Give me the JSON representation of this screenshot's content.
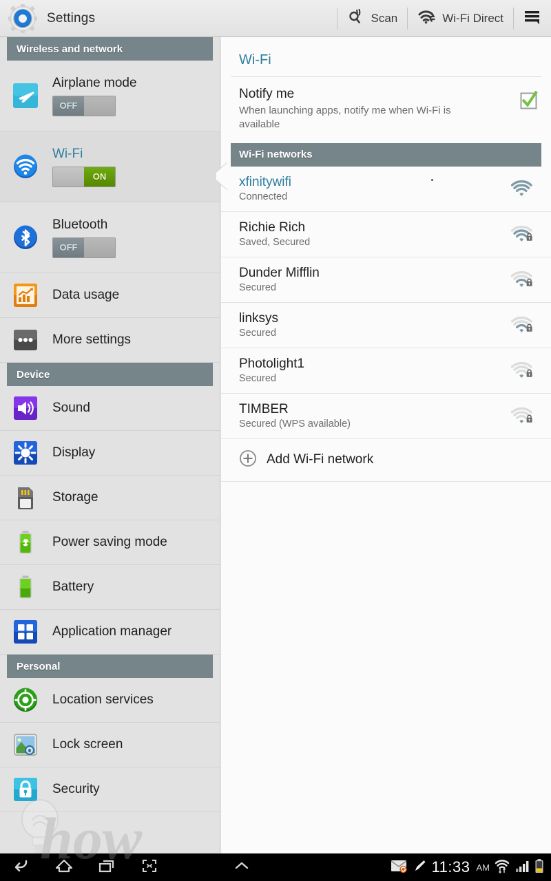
{
  "actionbar": {
    "app_icon": "settings-gear-icon",
    "title": "Settings",
    "scan_label": "Scan",
    "scan_icon": "scan-search-icon",
    "wifi_direct_label": "Wi-Fi Direct",
    "wifi_direct_icon": "wifi-direct-icon",
    "menu_icon": "overflow-menu-icon"
  },
  "sidebar": {
    "sections": [
      {
        "header": "Wireless and network",
        "items": [
          {
            "label": "Airplane mode",
            "icon": "airplane-icon",
            "toggle": "OFF",
            "selected": false
          },
          {
            "label": "Wi-Fi",
            "icon": "wifi-icon",
            "toggle": "ON",
            "selected": true
          },
          {
            "label": "Bluetooth",
            "icon": "bluetooth-icon",
            "toggle": "OFF",
            "selected": false
          },
          {
            "label": "Data usage",
            "icon": "data-usage-icon",
            "selected": false
          },
          {
            "label": "More settings",
            "icon": "more-settings-icon",
            "selected": false
          }
        ]
      },
      {
        "header": "Device",
        "items": [
          {
            "label": "Sound",
            "icon": "sound-icon",
            "selected": false
          },
          {
            "label": "Display",
            "icon": "display-icon",
            "selected": false
          },
          {
            "label": "Storage",
            "icon": "storage-icon",
            "selected": false
          },
          {
            "label": "Power saving mode",
            "icon": "power-saving-icon",
            "selected": false
          },
          {
            "label": "Battery",
            "icon": "battery-icon",
            "selected": false
          },
          {
            "label": "Application manager",
            "icon": "application-manager-icon",
            "selected": false
          }
        ]
      },
      {
        "header": "Personal",
        "items": [
          {
            "label": "Location services",
            "icon": "location-services-icon",
            "selected": false
          },
          {
            "label": "Lock screen",
            "icon": "lock-screen-icon",
            "selected": false
          },
          {
            "label": "Security",
            "icon": "security-lock-icon",
            "selected": false
          }
        ]
      }
    ]
  },
  "detail": {
    "title": "Wi-Fi",
    "notify": {
      "title": "Notify me",
      "subtitle": "When launching apps, notify me when Wi-Fi is available",
      "checked": true
    },
    "networks_header": "Wi-Fi networks",
    "networks": [
      {
        "name": "xfinitywifi",
        "status": "Connected",
        "bars": 4,
        "secured": false,
        "connected": true
      },
      {
        "name": "Richie Rich",
        "status": "Saved, Secured",
        "bars": 3,
        "secured": true,
        "connected": false
      },
      {
        "name": "Dunder Mifflin",
        "status": "Secured",
        "bars": 2,
        "secured": true,
        "connected": false
      },
      {
        "name": "linksys",
        "status": "Secured",
        "bars": 2,
        "secured": true,
        "connected": false
      },
      {
        "name": "Photolight1",
        "status": "Secured",
        "bars": 1,
        "secured": true,
        "connected": false
      },
      {
        "name": "TIMBER",
        "status": "Secured (WPS available)",
        "bars": 1,
        "secured": true,
        "connected": false
      }
    ],
    "add_network_label": "Add Wi-Fi network",
    "add_network_icon": "plus-circle-icon"
  },
  "systembar": {
    "back_icon": "back-icon",
    "home_icon": "home-icon",
    "recents_icon": "recent-apps-icon",
    "screenshot_icon": "screen-capture-icon",
    "expand_icon": "chevron-up-icon",
    "email_icon": "email-sync-icon",
    "pen_icon": "stylus-pen-icon",
    "time": "11:33",
    "ampm": "AM",
    "wifi_icon": "wifi-status-icon",
    "signal_icon": "cellular-signal-icon",
    "battery_icon": "battery-status-icon"
  },
  "watermark": {
    "text": "how"
  },
  "colors": {
    "accent_blue": "#2f7d9e",
    "section_header": "#76858a",
    "toggle_on": "#558800",
    "sidebar_bg": "#e2e2e2",
    "panel_bg": "#fbfbfb"
  }
}
